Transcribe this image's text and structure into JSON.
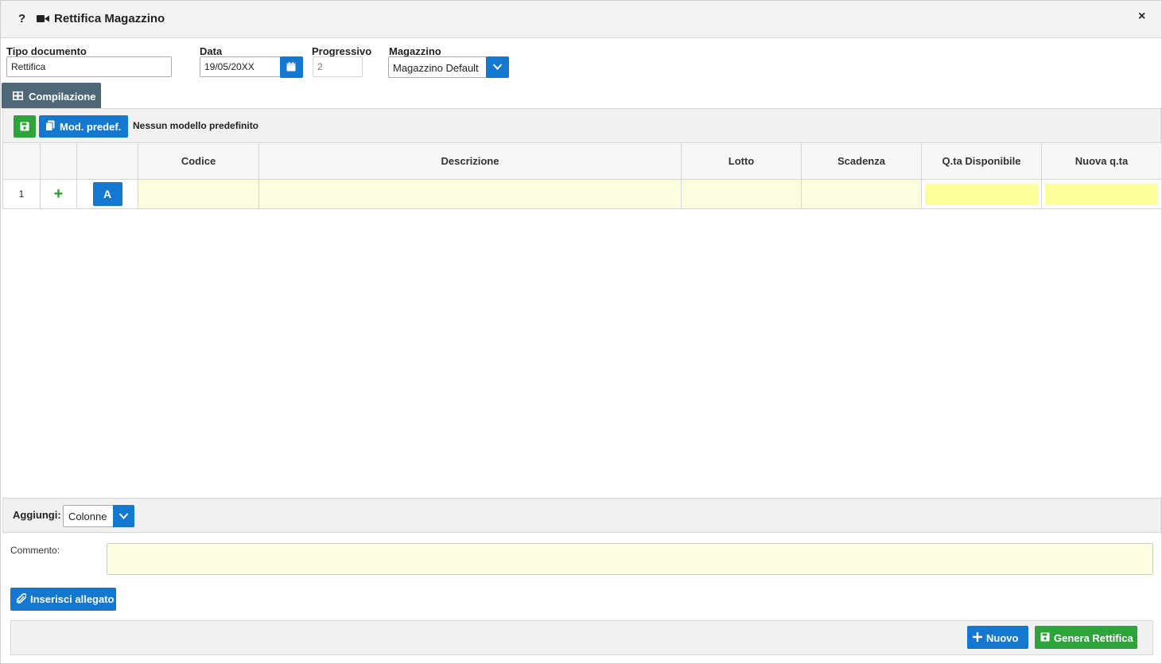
{
  "window": {
    "title": "Rettifica Magazzino",
    "help_glyph": "?",
    "close_glyph": "×"
  },
  "form": {
    "tipo_documento": {
      "label": "Tipo documento",
      "value": "Rettifica"
    },
    "data": {
      "label": "Data",
      "value": "19/05/20XX"
    },
    "progressivo": {
      "label": "Progressivo",
      "placeholder": "2"
    },
    "magazzino": {
      "label": "Magazzino",
      "value": "Magazzino Default"
    }
  },
  "tabs": [
    {
      "label": "Compilazione",
      "icon": "table-icon",
      "active": true
    }
  ],
  "toolbar": {
    "mod_predef_label": "Mod. predef.",
    "model_status": "Nessun modello predefinito"
  },
  "grid": {
    "columns": [
      "",
      "",
      "",
      "Codice",
      "Descrizione",
      "Lotto",
      "Scadenza",
      "Q.ta Disponibile",
      "Nuova q.ta"
    ],
    "rows": [
      {
        "num": "1",
        "add_glyph": "+",
        "a_label": "A",
        "codice": "",
        "descrizione": "",
        "lotto": "",
        "scadenza": "",
        "qta_disponibile": "",
        "nuova_qta": ""
      }
    ]
  },
  "aggiungi": {
    "label": "Aggiungi:",
    "selected": "Colonne"
  },
  "commento": {
    "label": "Commento:",
    "value": ""
  },
  "buttons": {
    "inserisci_allegato": "Inserisci allegato",
    "nuovo": "Nuovo",
    "genera_rettifica": "Genera Rettifica"
  },
  "colors": {
    "primary_blue": "#1477d0",
    "success_green": "#2ca43a",
    "tab_slate": "#4f6878",
    "editable_yellow": "#fdfde0",
    "highlight_yellow": "#fdfd9c"
  }
}
